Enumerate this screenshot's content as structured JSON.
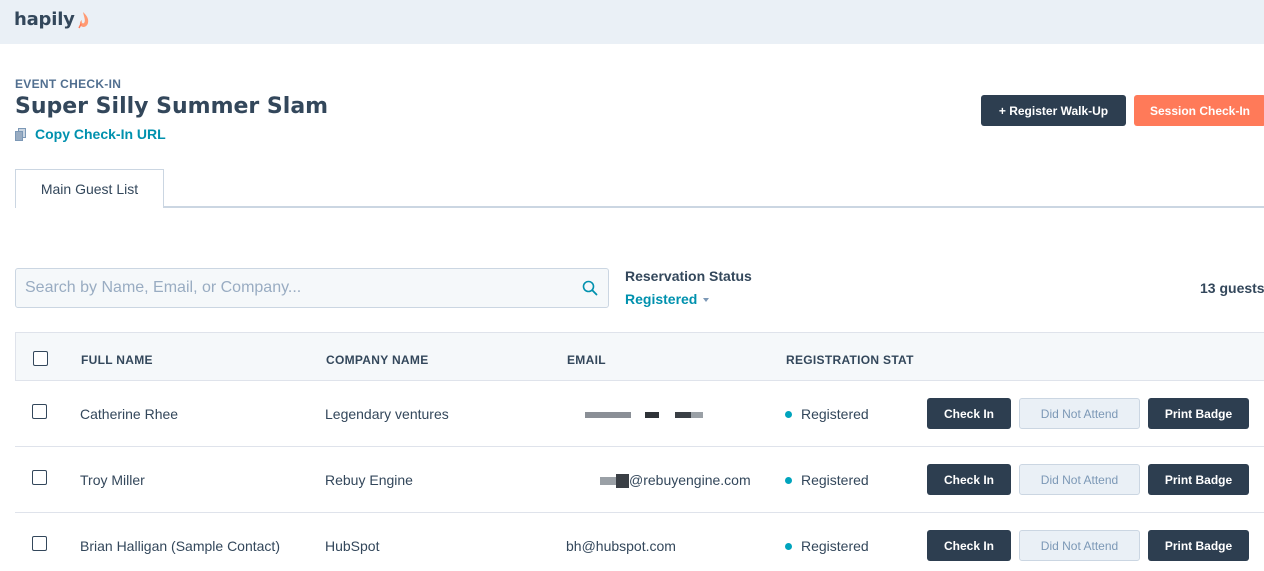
{
  "app": {
    "logo": "hapily",
    "colors": {
      "brand_dark": "#2d3e50",
      "accent_orange": "#ff7a59",
      "link_teal": "#0091ae",
      "status_dot": "#00a4bd"
    }
  },
  "header": {
    "eyebrow": "EVENT CHECK-IN",
    "title": "Super Silly Summer Slam",
    "copy_link": "Copy Check-In URL",
    "copy_icon": "copy-icon",
    "register_walkup": "+ Register Walk-Up",
    "session_checkin": "Session Check-In"
  },
  "tabs": [
    {
      "label": "Main Guest List",
      "active": true
    }
  ],
  "search": {
    "placeholder": "Search by Name, Email, or Company...",
    "value": "",
    "icon": "search-icon"
  },
  "filter": {
    "label": "Reservation Status",
    "value": "Registered"
  },
  "guest_count": "13 guests",
  "table": {
    "columns": [
      "FULL NAME",
      "COMPANY NAME",
      "EMAIL",
      "REGISTRATION STAT"
    ],
    "rows": [
      {
        "name": "Catherine Rhee",
        "company": "Legendary ventures",
        "email": "",
        "status": "Registered"
      },
      {
        "name": "Troy Miller",
        "company": "Rebuy Engine",
        "email": "@rebuyengine.com",
        "status": "Registered"
      },
      {
        "name": "Brian Halligan (Sample Contact)",
        "company": "HubSpot",
        "email": "bh@hubspot.com",
        "status": "Registered"
      }
    ],
    "actions": {
      "check_in": "Check In",
      "did_not_attend": "Did Not Attend",
      "print_badge": "Print Badge"
    }
  }
}
